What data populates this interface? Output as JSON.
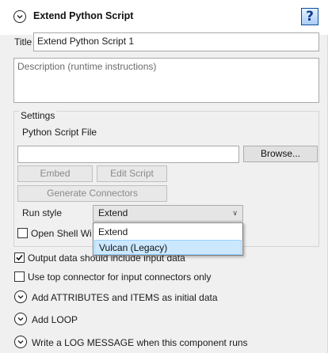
{
  "header": {
    "title": "Extend Python Script",
    "help_glyph": "?",
    "collapse_icon": "chevron-down-circle-icon",
    "help_icon": "help-icon"
  },
  "title_field": {
    "label": "Title",
    "value": "Extend Python Script 1"
  },
  "description_field": {
    "placeholder": "Description (runtime instructions)"
  },
  "settings": {
    "group_label": "Settings",
    "script_file_label": "Python Script File",
    "script_file_value": "",
    "browse_label": "Browse...",
    "embed_label": "Embed",
    "edit_script_label": "Edit Script",
    "generate_connectors_label": "Generate Connectors",
    "run_style_label": "Run style",
    "run_style_value": "Extend",
    "run_style_options": [
      "Extend",
      "Vulcan (Legacy)"
    ],
    "open_shell_label": "Open Shell Wi",
    "open_shell_checked": false
  },
  "options": {
    "output_data_label": "Output data should include input data",
    "output_data_checked": true,
    "top_connector_label": "Use top connector for input connectors only",
    "top_connector_checked": false
  },
  "sections": [
    {
      "label": "Add ATTRIBUTES and ITEMS as initial data",
      "icon": "chevron-down-circle-icon"
    },
    {
      "label": "Add LOOP",
      "icon": "chevron-down-circle-icon"
    },
    {
      "label": "Write a LOG MESSAGE when this component runs",
      "icon": "chevron-down-circle-icon"
    }
  ],
  "colors": {
    "panel_bg": "#f0f0f0",
    "dropdown_selection": "#cce8ff",
    "help_accent": "#0a4f9e"
  }
}
